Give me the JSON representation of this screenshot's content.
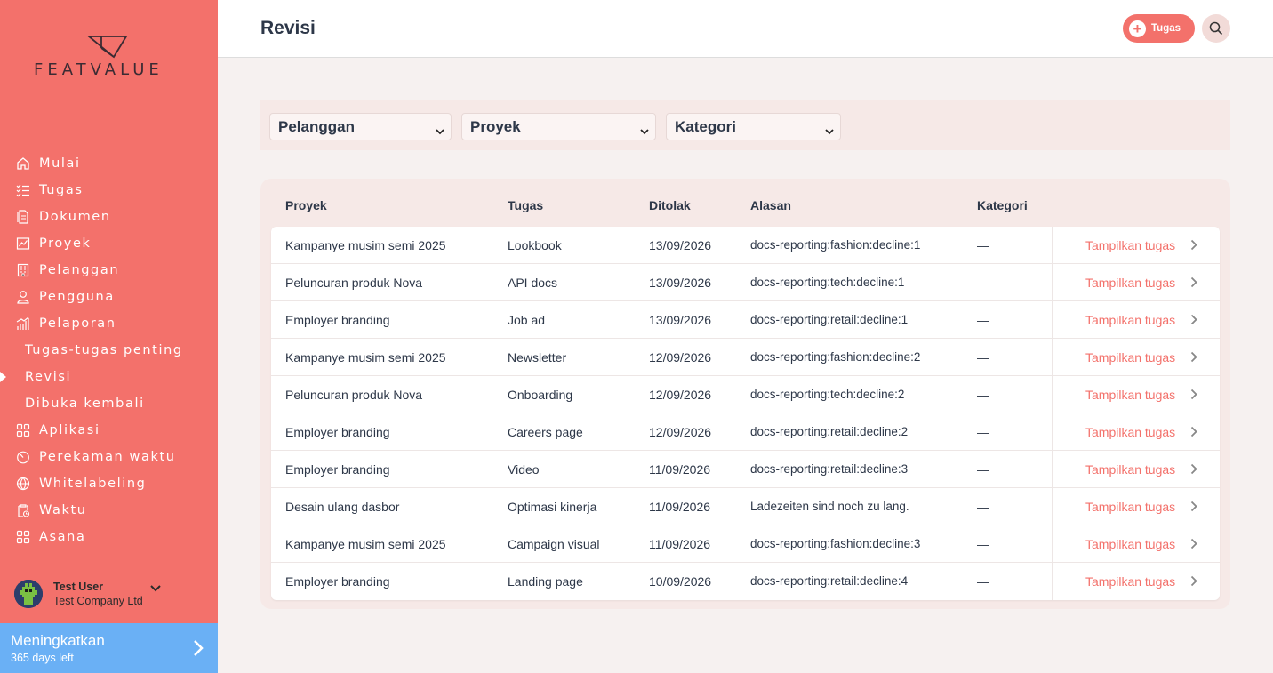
{
  "brand": {
    "name": "FEATVALUE"
  },
  "sidebar": {
    "items": [
      {
        "label": "Mulai",
        "icon": "home-icon"
      },
      {
        "label": "Tugas",
        "icon": "checklist-icon"
      },
      {
        "label": "Dokumen",
        "icon": "document-icon"
      },
      {
        "label": "Proyek",
        "icon": "project-chart-icon"
      },
      {
        "label": "Pelanggan",
        "icon": "building-icon"
      },
      {
        "label": "Pengguna",
        "icon": "user-icon"
      },
      {
        "label": "Pelaporan",
        "icon": "bar-chart-icon"
      },
      {
        "label": "Tugas-tugas penting",
        "sub": true
      },
      {
        "label": "Revisi",
        "sub": true,
        "active": true
      },
      {
        "label": "Dibuka kembali",
        "sub": true
      },
      {
        "label": "Aplikasi",
        "icon": "apps-icon"
      },
      {
        "label": "Perekaman waktu",
        "icon": "timer-icon"
      },
      {
        "label": "Whitelabeling",
        "icon": "globe-icon"
      },
      {
        "label": "Waktu",
        "icon": "clipboard-clock-icon"
      },
      {
        "label": "Asana",
        "icon": "apps-icon"
      }
    ]
  },
  "user": {
    "name": "Test User",
    "company": "Test Company Ltd"
  },
  "upgrade": {
    "title": "Meningkatkan",
    "subtitle": "365 days left"
  },
  "header": {
    "title": "Revisi",
    "add_task_label": "Tugas"
  },
  "filters": {
    "customer": "Pelanggan",
    "project": "Proyek",
    "category": "Kategori"
  },
  "table": {
    "headers": {
      "project": "Proyek",
      "task": "Tugas",
      "rejected": "Ditolak",
      "reason": "Alasan",
      "category": "Kategori"
    },
    "action_label": "Tampilkan tugas",
    "rows": [
      {
        "project": "Kampanye musim semi 2025",
        "task": "Lookbook",
        "rejected": "13/09/2026",
        "reason": "docs-reporting:fashion:decline:1",
        "category": "—"
      },
      {
        "project": "Peluncuran produk Nova",
        "task": "API docs",
        "rejected": "13/09/2026",
        "reason": "docs-reporting:tech:decline:1",
        "category": "—"
      },
      {
        "project": "Employer branding",
        "task": "Job ad",
        "rejected": "13/09/2026",
        "reason": "docs-reporting:retail:decline:1",
        "category": "—"
      },
      {
        "project": "Kampanye musim semi 2025",
        "task": "Newsletter",
        "rejected": "12/09/2026",
        "reason": "docs-reporting:fashion:decline:2",
        "category": "—"
      },
      {
        "project": "Peluncuran produk Nova",
        "task": "Onboarding",
        "rejected": "12/09/2026",
        "reason": "docs-reporting:tech:decline:2",
        "category": "—"
      },
      {
        "project": "Employer branding",
        "task": "Careers page",
        "rejected": "12/09/2026",
        "reason": "docs-reporting:retail:decline:2",
        "category": "—"
      },
      {
        "project": "Employer branding",
        "task": "Video",
        "rejected": "11/09/2026",
        "reason": "docs-reporting:retail:decline:3",
        "category": "—"
      },
      {
        "project": "Desain ulang dasbor",
        "task": "Optimasi kinerja",
        "rejected": "11/09/2026",
        "reason": "Ladezeiten sind noch zu lang.",
        "category": "—"
      },
      {
        "project": "Kampanye musim semi 2025",
        "task": "Campaign visual",
        "rejected": "11/09/2026",
        "reason": "docs-reporting:fashion:decline:3",
        "category": "—"
      },
      {
        "project": "Employer branding",
        "task": "Landing page",
        "rejected": "10/09/2026",
        "reason": "docs-reporting:retail:decline:4",
        "category": "—"
      }
    ]
  },
  "colors": {
    "accent": "#f3716b",
    "upgrade": "#6ab0f5",
    "text": "#2d3748"
  }
}
